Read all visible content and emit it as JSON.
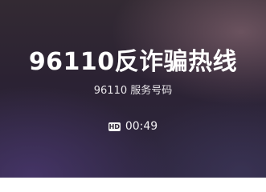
{
  "call": {
    "title": "96110反诈骗热线",
    "subtitle": "96110 服务号码",
    "quality_badge": "HD",
    "duration": "00:49"
  }
}
